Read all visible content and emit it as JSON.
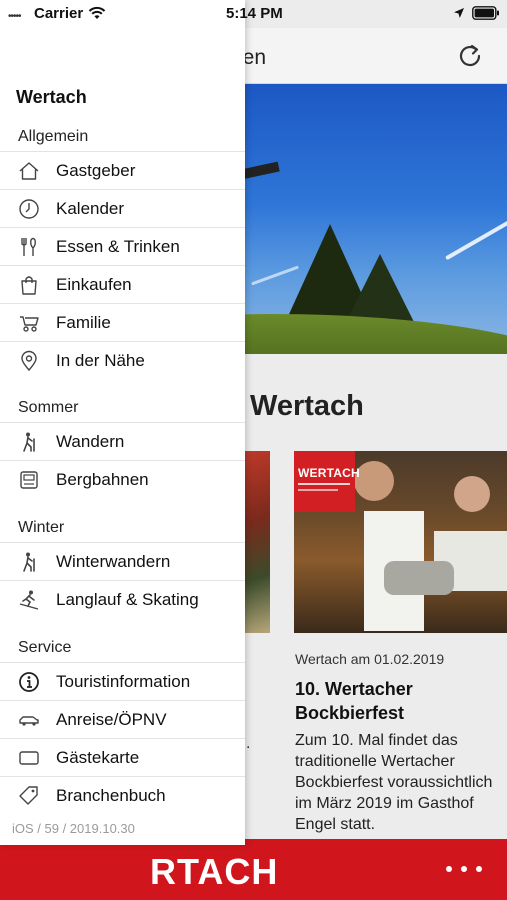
{
  "status_bar": {
    "carrier": "Carrier",
    "time": "5:14 PM",
    "signal_dots": "•••••"
  },
  "page": {
    "nav_title_partial": "ommen",
    "section_heading_partial": "Wertach",
    "left_card_fragment": ".",
    "card": {
      "badge_text": "WERTACH",
      "meta": "Wertach am 01.02.2019",
      "title": "10. Wertacher Bockbierfest",
      "text_lines": [
        "Zum 10. Mal findet das",
        "traditionelle Wertacher",
        "Bockbierfest voraussichtlich",
        "im März 2019 im Gasthof",
        "Engel statt."
      ]
    },
    "bottom_brand_partial": "RTACH",
    "accent_color": "#d0161c"
  },
  "drawer": {
    "title": "Wertach",
    "sections": [
      {
        "header": "Allgemein",
        "items": [
          {
            "label": "Gastgeber",
            "icon": "house-icon"
          },
          {
            "label": "Kalender",
            "icon": "clock-icon"
          },
          {
            "label": "Essen & Trinken",
            "icon": "cutlery-icon"
          },
          {
            "label": "Einkaufen",
            "icon": "shopping-bag-icon"
          },
          {
            "label": "Familie",
            "icon": "stroller-icon"
          },
          {
            "label": "In der Nähe",
            "icon": "location-pin-icon"
          }
        ]
      },
      {
        "header": "Sommer",
        "items": [
          {
            "label": "Wandern",
            "icon": "hiker-icon"
          },
          {
            "label": "Bergbahnen",
            "icon": "cable-car-icon"
          }
        ]
      },
      {
        "header": "Winter",
        "items": [
          {
            "label": "Winterwandern",
            "icon": "winter-hiker-icon"
          },
          {
            "label": "Langlauf & Skating",
            "icon": "skier-icon"
          }
        ]
      },
      {
        "header": "Service",
        "items": [
          {
            "label": "Touristinformation",
            "icon": "info-icon"
          },
          {
            "label": "Anreise/ÖPNV",
            "icon": "car-icon"
          },
          {
            "label": "Gästekarte",
            "icon": "card-icon"
          },
          {
            "label": "Branchenbuch",
            "icon": "tag-icon"
          }
        ]
      }
    ],
    "footer": "iOS / 59 / 2019.10.30"
  }
}
